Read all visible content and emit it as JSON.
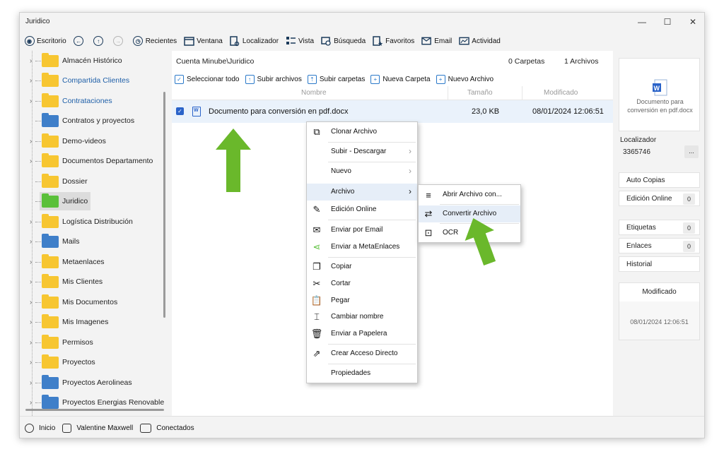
{
  "window": {
    "title": "Juridico",
    "controls": [
      "—",
      "☐",
      "✕"
    ]
  },
  "toolbar": {
    "items": [
      {
        "label": "Escritorio",
        "icon": "desktop-icon"
      },
      {
        "label": "",
        "icon": "back-icon"
      },
      {
        "label": "",
        "icon": "up-icon"
      },
      {
        "label": "",
        "icon": "forward-icon"
      },
      {
        "label": "Recientes",
        "icon": "recent-icon"
      },
      {
        "label": "Ventana",
        "icon": "window-icon"
      },
      {
        "label": "Localizador",
        "icon": "locator-icon"
      },
      {
        "label": "Vista",
        "icon": "view-icon"
      },
      {
        "label": "Búsqueda",
        "icon": "search-icon"
      },
      {
        "label": "Favoritos",
        "icon": "favorites-icon"
      },
      {
        "label": "Email",
        "icon": "email-icon"
      },
      {
        "label": "Actividad",
        "icon": "activity-icon"
      }
    ]
  },
  "sidebar": {
    "items": [
      {
        "label": "Almacén Histórico",
        "color": "yellow",
        "expandable": true
      },
      {
        "label": "Compartida Clientes",
        "color": "yellow",
        "expandable": true,
        "link": true
      },
      {
        "label": "Contrataciones",
        "color": "yellow",
        "expandable": true,
        "link": true
      },
      {
        "label": "Contratos y proyectos",
        "color": "blue",
        "expandable": false
      },
      {
        "label": "Demo-videos",
        "color": "yellow",
        "expandable": true
      },
      {
        "label": "Documentos Departamento",
        "color": "yellow",
        "expandable": true
      },
      {
        "label": "Dossier",
        "color": "yellow",
        "expandable": false
      },
      {
        "label": "Juridico",
        "color": "green",
        "expandable": false,
        "selected": true
      },
      {
        "label": "Logística Distribución",
        "color": "yellow",
        "expandable": true
      },
      {
        "label": "Mails",
        "color": "blue",
        "expandable": true
      },
      {
        "label": "Metaenlaces",
        "color": "yellow",
        "expandable": true
      },
      {
        "label": "Mis Clientes",
        "color": "yellow",
        "expandable": true
      },
      {
        "label": "Mis Documentos",
        "color": "yellow",
        "expandable": true
      },
      {
        "label": "Mis Imagenes",
        "color": "yellow",
        "expandable": true
      },
      {
        "label": "Permisos",
        "color": "yellow",
        "expandable": true
      },
      {
        "label": "Proyectos",
        "color": "yellow",
        "expandable": true
      },
      {
        "label": "Proyectos Aerolineas",
        "color": "blue",
        "expandable": true
      },
      {
        "label": "Proyectos Energias Renovable",
        "color": "blue",
        "expandable": true
      }
    ]
  },
  "main": {
    "breadcrumb": "Cuenta Minube\\Juridico",
    "folders_count": "0 Carpetas",
    "files_count": "1 Archivos",
    "actions": [
      {
        "label": "Seleccionar todo",
        "icon": "select-all-icon"
      },
      {
        "label": "Subir archivos",
        "icon": "upload-files-icon"
      },
      {
        "label": "Subir carpetas",
        "icon": "upload-folders-icon"
      },
      {
        "label": "Nueva Carpeta",
        "icon": "new-folder-icon"
      },
      {
        "label": "Nuevo Archivo",
        "icon": "new-file-icon"
      }
    ],
    "columns": {
      "name": "Nombre",
      "size": "Tamaño",
      "modified": "Modificado"
    },
    "file": {
      "name": "Documento para conversión en pdf.docx",
      "size": "23,0 KB",
      "modified": "08/01/2024 12:06:51",
      "checked": true
    }
  },
  "context_menu": {
    "items": [
      {
        "label": "Clonar Archivo",
        "icon": "clone-icon"
      },
      {
        "label": "Subir - Descargar",
        "submenu": true
      },
      {
        "label": "Nuevo",
        "submenu": true
      },
      {
        "label": "Archivo",
        "submenu": true,
        "highlighted": true
      },
      {
        "label": "Edición Online",
        "icon": "edit-online-icon"
      },
      {
        "label": "Enviar por Email",
        "icon": "send-email-icon"
      },
      {
        "label": "Enviar a MetaEnlaces",
        "icon": "share-icon"
      },
      {
        "label": "Copiar",
        "icon": "copy-icon"
      },
      {
        "label": "Cortar",
        "icon": "cut-icon"
      },
      {
        "label": "Pegar",
        "icon": "paste-icon"
      },
      {
        "label": "Cambiar nombre",
        "icon": "rename-icon"
      },
      {
        "label": "Enviar a Papelera",
        "icon": "trash-icon"
      },
      {
        "label": "Crear Acceso Directo",
        "icon": "shortcut-icon"
      },
      {
        "label": "Propiedades"
      }
    ]
  },
  "submenu": {
    "items": [
      {
        "label": "Abrir Archivo con...",
        "icon": "open-with-icon"
      },
      {
        "label": "Convertir Archivo",
        "icon": "convert-icon",
        "highlighted": true
      },
      {
        "label": "OCR",
        "icon": "ocr-icon"
      }
    ]
  },
  "right_panel": {
    "preview_name": "Documento para conversión en pdf.docx",
    "locator_label": "Localizador",
    "locator_value": "3365746",
    "locator_button": "...",
    "auto_copies": "Auto Copias",
    "online_edit": "Edición Online",
    "online_edit_count": "0",
    "tags": "Etiquetas",
    "tags_count": "0",
    "links": "Enlaces",
    "links_count": "0",
    "history": "Historial",
    "modified_label": "Modificado",
    "modified_value": "08/01/2024 12:06:51"
  },
  "statusbar": {
    "home": "Inicio",
    "user": "Valentine Maxwell",
    "connected": "Conectados"
  },
  "colors": {
    "accent": "#2a63c9",
    "arrow": "#6ab82b",
    "folder_yellow": "#f7c631",
    "folder_blue": "#3f7fc9",
    "folder_green": "#5ac03a"
  }
}
